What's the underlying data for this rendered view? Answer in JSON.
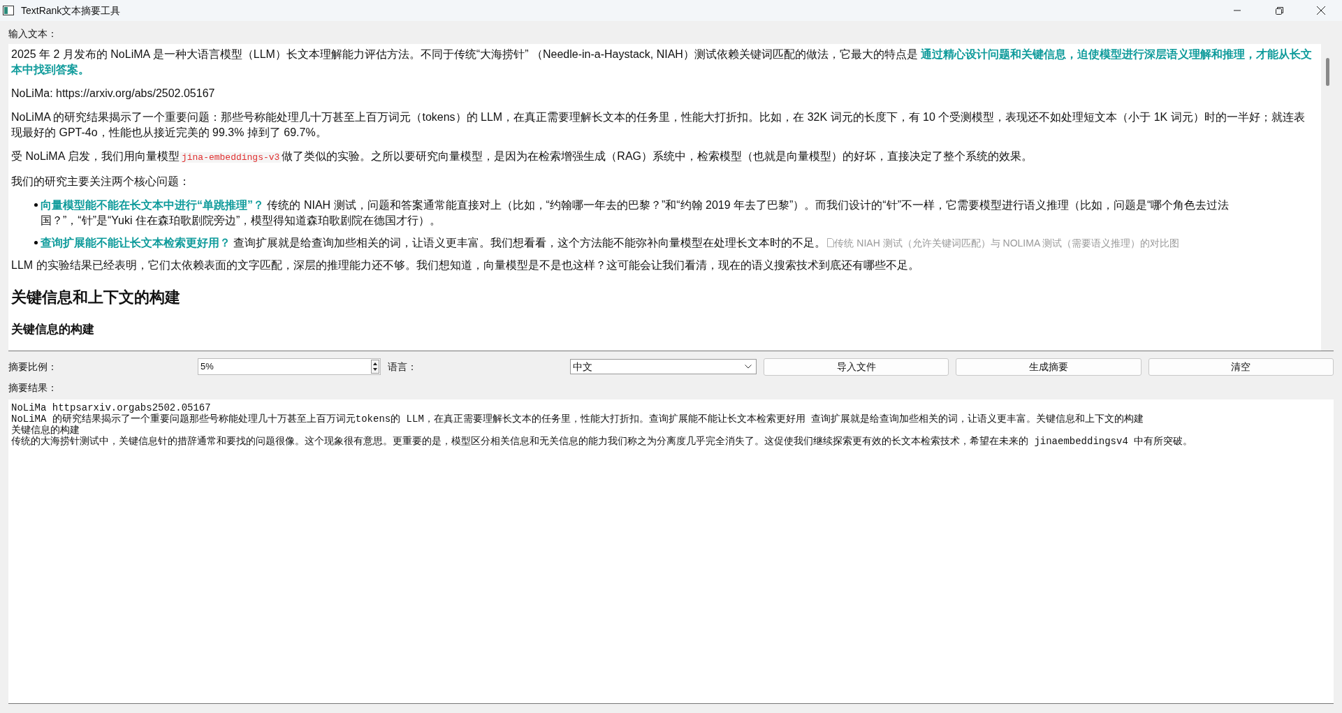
{
  "window": {
    "title": "TextRank文本摘要工具"
  },
  "input_label": "输入文本：",
  "document": [
    {
      "kind": "paragraph",
      "text": "2025 年 2 月发布的 NoLiMA 是一种大语言模型（LLM）长文本理解能力评估方法。不同于传统“大海捞针” （Needle-in-a-Haystack, NIAH）测试依赖关键词匹配的做法，它最大的特点是 **通过精心设计问题和关键信息，迫使模型进行深层语义理解和推理，才能从长文本中找到答案。**"
    },
    {
      "kind": "paragraph",
      "text": "NoLiMa: https://arxiv.org/abs/2502.05167"
    },
    {
      "kind": "paragraph",
      "text": "NoLiMA 的研究结果揭示了一个重要问题：那些号称能处理几十万甚至上百万词元（tokens）的 LLM，在真正需要理解长文本的任务里，性能大打折扣。比如，在 32K 词元的长度下，有 10 个受测模型，表现还不如处理短文本（小于 1K 词元）时的一半好；就连表现最好的 GPT-4o，性能也从接近完美的 99.3% 掉到了 69.7%。"
    },
    {
      "kind": "mixed",
      "parts": [
        {
          "kind": "text",
          "text": "受 NoLiMA 启发，我们用向量模型"
        },
        {
          "kind": "code",
          "text": "jina-embeddings-v3"
        },
        {
          "kind": "text",
          "text": "做了类似的实验。之所以要研究向量模型，是因为在检索增强生成（RAG）系统中，检索模型（也就是向量模型）的好坏，直接决定了整个系统的效果。"
        }
      ]
    },
    {
      "kind": "paragraph",
      "text": "我们的研究主要关注两个核心问题："
    },
    {
      "kind": "bullets",
      "items": [
        {
          "text": "**向量模型能不能在长文本中进行“单跳推理”？** 传统的 NIAH 测试，问题和答案通常能直接对上（比如，“约翰哪一年去的巴黎？”和“约翰 2019 年去了巴黎”）。而我们设计的“针”不一样，它需要模型进行语义推理（比如，问题是“哪个角色去过法国？”，“针”是“Yuki 住在森珀歌剧院旁边”，模型得知道森珀歌剧院在德国才行）。"
        },
        {
          "text": "**查询扩展能不能让长文本检索更好用？** 查询扩展就是给查询加些相关的词，让语义更丰富。我们想看看，这个方法能不能弥补向量模型在处理长文本时的不足。",
          "image_alt": "传统 NIAH 测试（允许关键词匹配）与 NOLIMA 测试（需要语义推理）的对比图"
        }
      ]
    },
    {
      "kind": "paragraph",
      "text": "LLM 的实验结果已经表明，它们太依赖表面的文字匹配，深层的推理能力还不够。我们想知道，向量模型是不是也这样？这可能会让我们看清，现在的语义搜索技术到底还有哪些不足。"
    },
    {
      "kind": "h2",
      "text": "关键信息和上下文的构建"
    },
    {
      "kind": "h3",
      "text": "关键信息的构建"
    }
  ],
  "controls": {
    "ratio_label": "摘要比例：",
    "ratio_value": "5%",
    "language_label": "语言：",
    "language_value": "中文",
    "buttons": [
      "导入文件",
      "生成摘要",
      "清空"
    ]
  },
  "result_label": "摘要结果：",
  "result_lines": [
    "NoLiMa httpsarxiv.orgabs2502.05167",
    "NoLiMA 的研究结果揭示了一个重要问题那些号称能处理几十万甚至上百万词元tokens的 LLM，在真正需要理解长文本的任务里，性能大打折扣。查询扩展能不能让长文本检索更好用 查询扩展就是给查询加些相关的词，让语义更丰富。关键信息和上下文的构建",
    "关键信息的构建",
    "传统的大海捞针测试中，关键信息针的措辞通常和要找的问题很像。这个现象很有意思。更重要的是，模型区分相关信息和无关信息的能力我们称之为分离度几乎完全消失了。这促使我们继续探索更有效的长文本检索技术，希望在未来的 jinaembeddingsv4 中有所突破。"
  ]
}
